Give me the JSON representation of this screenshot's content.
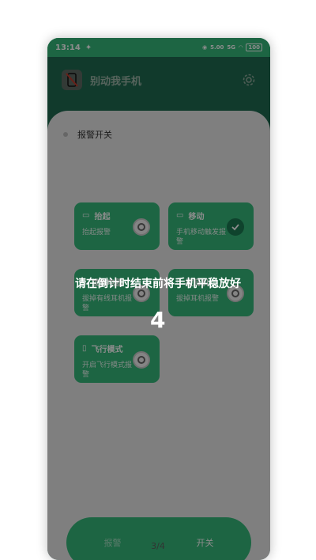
{
  "status_bar": {
    "time": "13:14",
    "speed": "5.00",
    "network": "5G",
    "battery": "100"
  },
  "app": {
    "title": "别动我手机"
  },
  "alarm_switch": {
    "label": "报警开关"
  },
  "cards": [
    {
      "title": "抬起",
      "desc": "抬起报警",
      "checked": false
    },
    {
      "title": "移动",
      "desc": "手机移动触发报警",
      "checked": true
    },
    {
      "title": "拔充电器",
      "desc": "拔掉有线耳机报警",
      "checked": false
    },
    {
      "title": "拔耳机",
      "desc": "拔掉耳机报警",
      "checked": false
    },
    {
      "title": "飞行模式",
      "desc": "开启飞行模式报警",
      "checked": false
    }
  ],
  "bottom": {
    "alarm_label": "报警",
    "switch_label": "开关"
  },
  "overlay": {
    "message": "请在倒计时结束前将手机平稳放好",
    "countdown": "4"
  },
  "pager": {
    "text": "3/4"
  },
  "colors": {
    "accent": "#35b97a",
    "dark": "#1f6b50"
  }
}
